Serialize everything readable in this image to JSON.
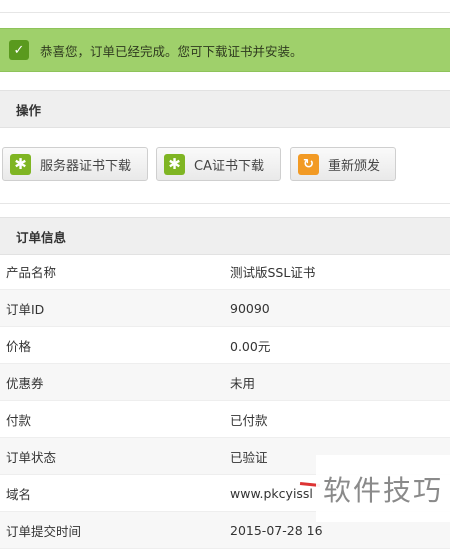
{
  "success": {
    "message": "恭喜您，订单已经完成。您可下载证书并安装。"
  },
  "actions": {
    "header": "操作",
    "buttons": [
      {
        "label": "服务器证书下载",
        "icon": "asterisk-icon",
        "color": "#7fb523"
      },
      {
        "label": "CA证书下载",
        "icon": "asterisk-icon",
        "color": "#7fb523"
      },
      {
        "label": "重新颁发",
        "icon": "refresh-icon",
        "color": "#f29a24"
      }
    ]
  },
  "order": {
    "header": "订单信息",
    "rows": [
      {
        "key": "产品名称",
        "value": "测试版SSL证书"
      },
      {
        "key": "订单ID",
        "value": "90090"
      },
      {
        "key": "价格",
        "value": "0.00元"
      },
      {
        "key": "优惠券",
        "value": "未用"
      },
      {
        "key": "付款",
        "value": "已付款"
      },
      {
        "key": "订单状态",
        "value": "已验证"
      },
      {
        "key": "域名",
        "value": "www.pkcyissl"
      },
      {
        "key": "订单提交时间",
        "value": "2015-07-28 16"
      }
    ]
  },
  "watermark": {
    "text": "软件技巧"
  }
}
